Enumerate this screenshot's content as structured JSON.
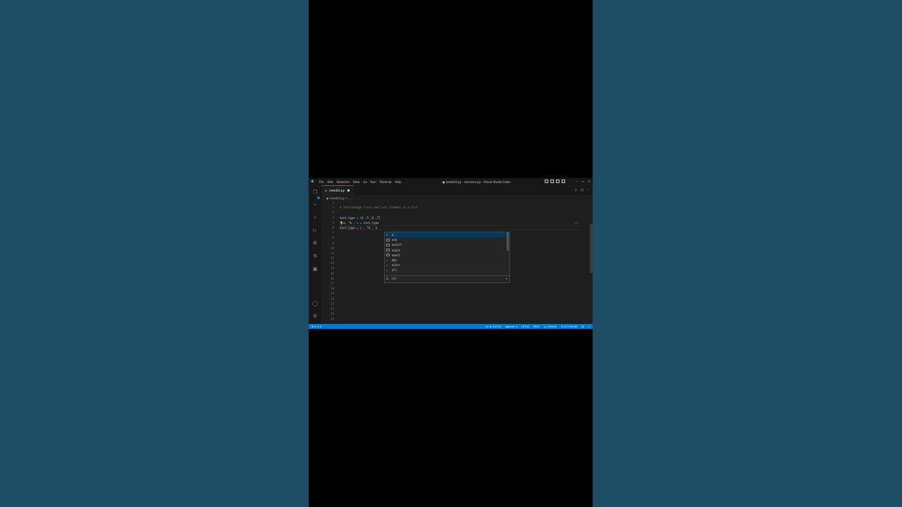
{
  "window": {
    "title": "● newdict.py - coursera.py - Visual Studio Code",
    "menu": [
      "File",
      "Edit",
      "Selection",
      "View",
      "Go",
      "Run",
      "Terminal",
      "Help"
    ],
    "controls": {
      "minimize": "–",
      "maximize": "▫",
      "close": "×"
    }
  },
  "tab": {
    "label": "newdict.py",
    "icon": "python-file-icon"
  },
  "breadcrumb": "◆ newdict.py > ...",
  "editor": {
    "line_numbers": [
      "1",
      "2",
      "3",
      "4",
      "5",
      "6",
      "7",
      "8",
      "9",
      "10",
      "11",
      "12",
      "13",
      "14",
      "15",
      "16",
      "17",
      "18",
      "19",
      "20",
      "21",
      "22",
      "23",
      "24"
    ],
    "lines": [
      "",
      "# Interchange first and last element in a list",
      "",
      "test_type = [4 ,5 ,6 ,7]",
      "a, *b , c = test_type",
      "test_type = c , *b , a",
      "",
      "",
      "",
      "",
      "",
      "",
      "",
      "",
      "",
      "",
      "",
      "",
      "",
      "",
      "",
      "",
      "",
      ""
    ],
    "bulb": "💡"
  },
  "suggest": {
    "items": [
      {
        "icon": "variable-icon",
        "label": "a",
        "selected": true
      },
      {
        "icon": "keyword-icon",
        "label": "and"
      },
      {
        "icon": "keyword-icon",
        "label": "assert"
      },
      {
        "icon": "keyword-icon",
        "label": "async"
      },
      {
        "icon": "keyword-icon",
        "label": "await"
      },
      {
        "icon": "function-icon",
        "label": "abs"
      },
      {
        "icon": "function-icon",
        "label": "aiter"
      },
      {
        "icon": "function-icon",
        "label": "all"
      }
    ],
    "detail": "a: int",
    "close": "×"
  },
  "status": {
    "left": "⊗ 0 ⚠ 0",
    "ln_col": "Ln 6, Col 23",
    "spaces": "Spaces: 4",
    "encoding": "UTF-8",
    "eol": "CRLF",
    "language": "{} Python",
    "interpreter": "3.10.5 64-bit"
  }
}
